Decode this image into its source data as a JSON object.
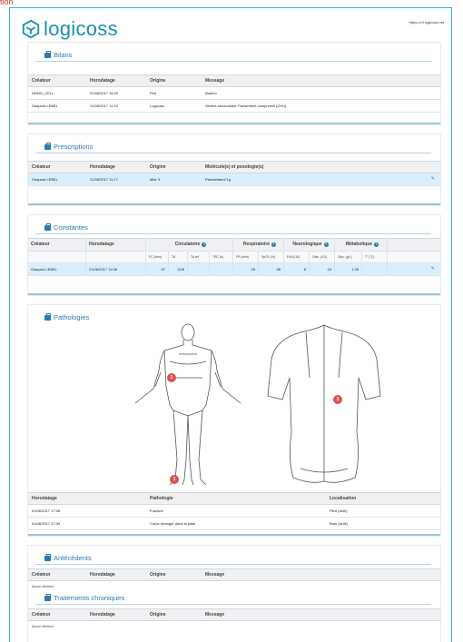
{
  "top_link": "tion",
  "brand": {
    "name": "logicoss",
    "url": "https://v3.logicoss.net",
    "color": "#1a8fb2"
  },
  "bilans": {
    "title": "Bilans",
    "headers": [
      "Créateur",
      "Horodatage",
      "Origine",
      "Message"
    ],
    "rows": [
      [
        "DEMO_CELL",
        "01/06/2017 16:02",
        "Ped",
        "blasino"
      ],
      [
        "Gaspard LEBEL",
        "21/06/2017 11:10",
        "Logicoss",
        "Gestes secouristes: Pansement compressif (CHU)."
      ]
    ]
  },
  "prescriptions": {
    "title": "Prescriptions",
    "headers": [
      "Créateur",
      "Horodatage",
      "Origine",
      "Molécule(s) et posologie(s)"
    ],
    "rows": [
      [
        "Gaspard LEBEL",
        "21/06/2017 11:17",
        "Mbe 3",
        "Paracétamol 1g"
      ]
    ]
  },
  "constantes": {
    "title": "Constantes",
    "group_headers": [
      "Créateur",
      "Horodatage",
      "Circulatoire",
      "Respiratoire",
      "Neurologique",
      "Métabolique"
    ],
    "sub_headers": [
      "FC (/min)",
      "TA",
      "TA réf",
      "TRC (s)",
      "FR (/min)",
      "SpO2 (%)",
      "EVA (/10)",
      "Glas. (/15)",
      "Glyc. (g/L)",
      "T° (°C)"
    ],
    "row": [
      "Gaspard LEBEL",
      "21/06/2017 11:08",
      "57",
      "12/8",
      "",
      "",
      "25",
      "98",
      "8",
      "15",
      "1.35",
      ""
    ]
  },
  "pathologies": {
    "title": "Pathologies",
    "pins": [
      "1",
      "1",
      "1"
    ],
    "headers": [
      "Horodatage",
      "Pathologie",
      "Localisation"
    ],
    "rows": [
      [
        "01/06/2017 17:06",
        "Fracture",
        "Pied (droit)"
      ],
      [
        "01/06/2017 17:39",
        "Corps étranger dans la plaie",
        "Bras (droit)"
      ]
    ]
  },
  "antecedents": {
    "title": "Antécédents",
    "headers": [
      "Créateur",
      "Horodatage",
      "Origine",
      "Message"
    ],
    "empty": "Aucun élément"
  },
  "traitements": {
    "title": "Traitements chroniques",
    "headers": [
      "Créateur",
      "Horodatage",
      "Origine",
      "Message"
    ],
    "empty": "Aucun élément"
  },
  "colors": {
    "frame": "#38b0c8",
    "accent": "#2a7ab0",
    "highlight_row": "#daeefb",
    "pin": "#d9534f"
  }
}
